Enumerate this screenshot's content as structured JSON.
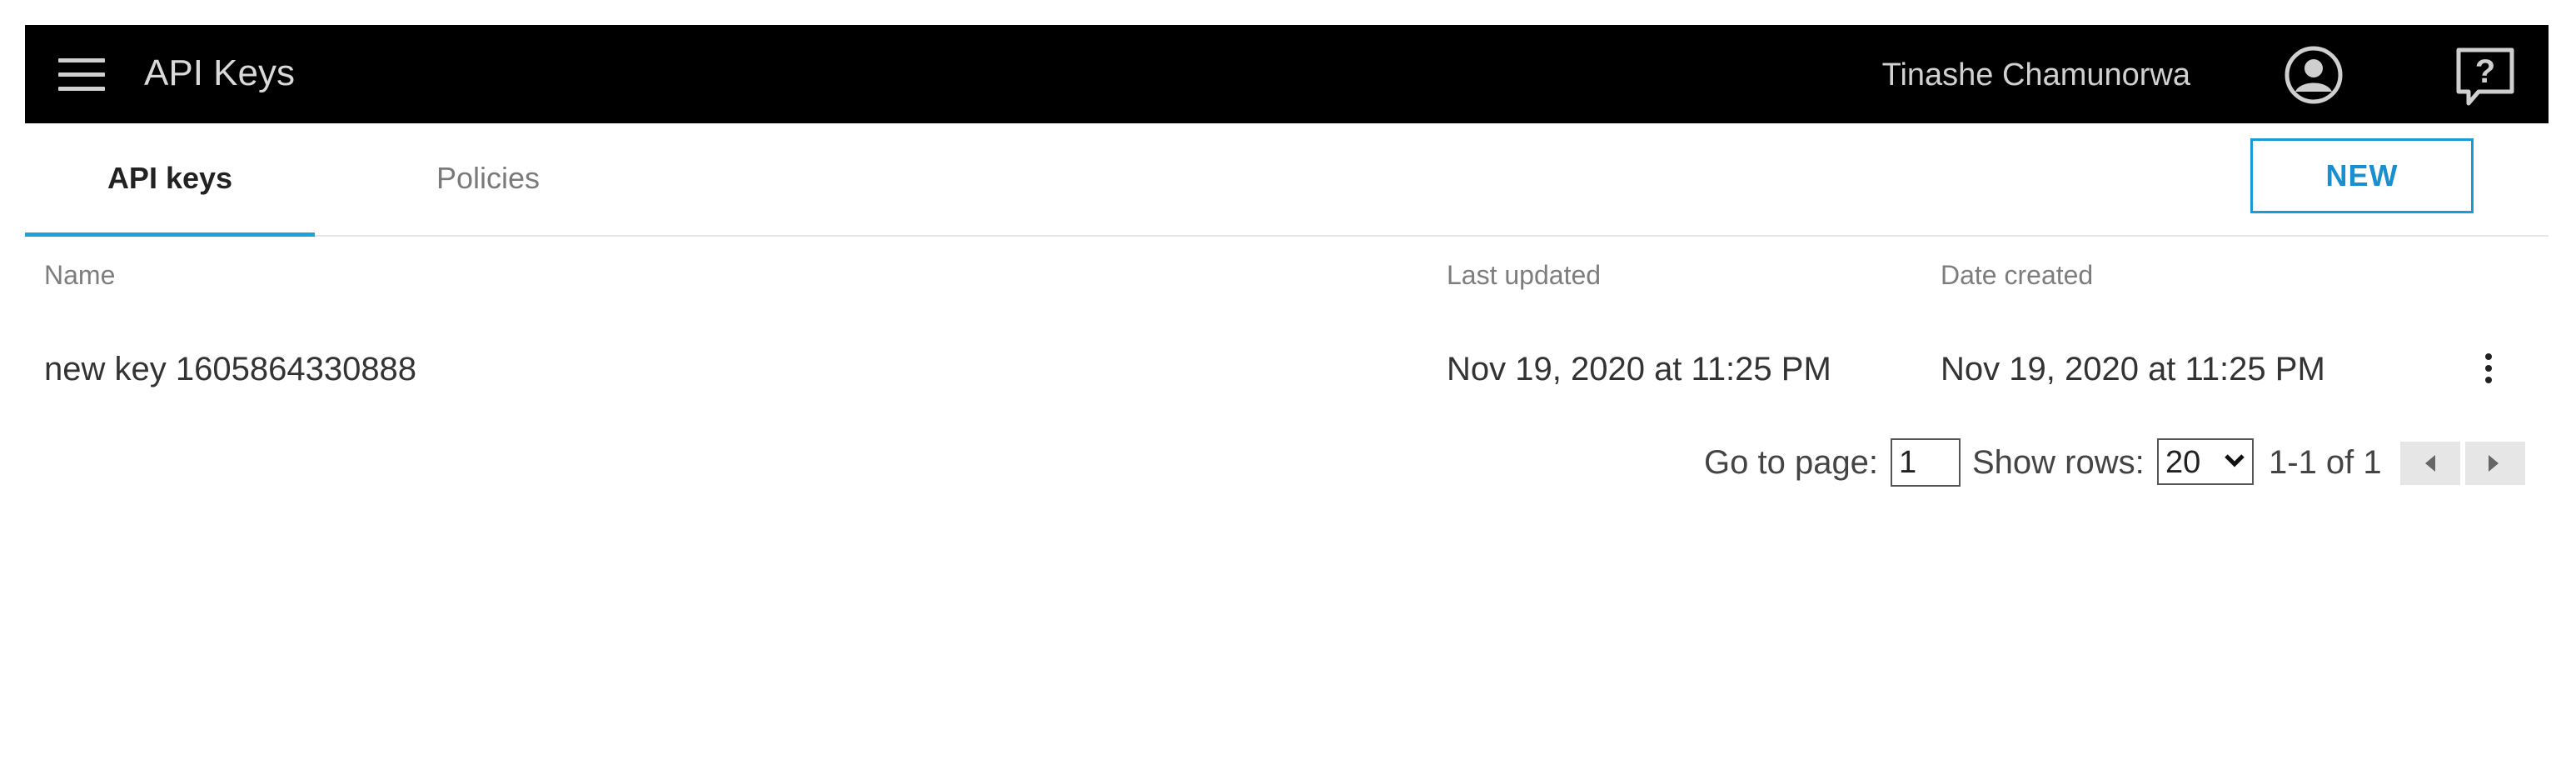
{
  "header": {
    "title": "API Keys",
    "user_name": "Tinashe Chamunorwa",
    "menu_icon": "hamburger-menu-icon",
    "avatar_icon": "account-circle-icon",
    "help_icon": "help-question-icon",
    "background_color": "#000000"
  },
  "tabs": [
    {
      "label": "API keys",
      "active": true
    },
    {
      "label": "Policies",
      "active": false
    }
  ],
  "new_button": {
    "label": "NEW",
    "color": "#1a9ad6"
  },
  "table": {
    "columns": [
      "Name",
      "Last updated",
      "Date created"
    ],
    "rows": [
      {
        "name": "new key 1605864330888",
        "last_updated": "Nov 19, 2020 at 11:25 PM",
        "date_created": "Nov 19, 2020 at 11:25 PM",
        "menu_icon": "more-vertical-icon"
      }
    ]
  },
  "pagination": {
    "go_to_label": "Go to page:",
    "page_value": "1",
    "show_rows_label": "Show rows:",
    "rows_value": "20",
    "range_text": "1-1 of 1",
    "prev_icon": "chevron-left-icon",
    "next_icon": "chevron-right-icon"
  },
  "accent_color": "#1aa3d8"
}
